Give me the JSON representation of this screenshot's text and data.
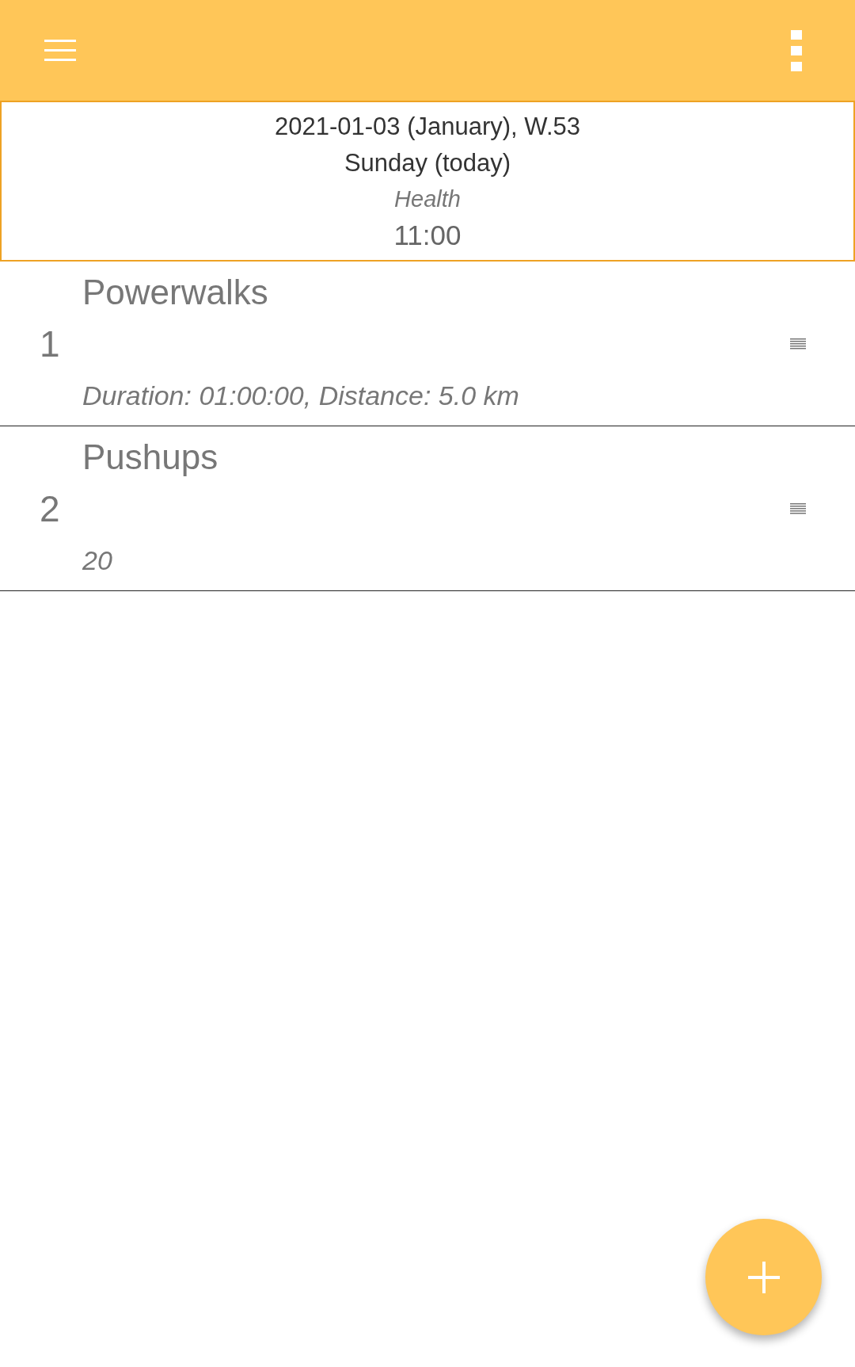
{
  "header": {
    "date": "2021-01-03 (January), W.53",
    "day": "Sunday (today)",
    "category": "Health",
    "time": "11:00"
  },
  "items": [
    {
      "number": "1",
      "name": "Powerwalks",
      "details": "Duration: 01:00:00, Distance: 5.0 km"
    },
    {
      "number": "2",
      "name": "Pushups",
      "details": "20"
    }
  ]
}
